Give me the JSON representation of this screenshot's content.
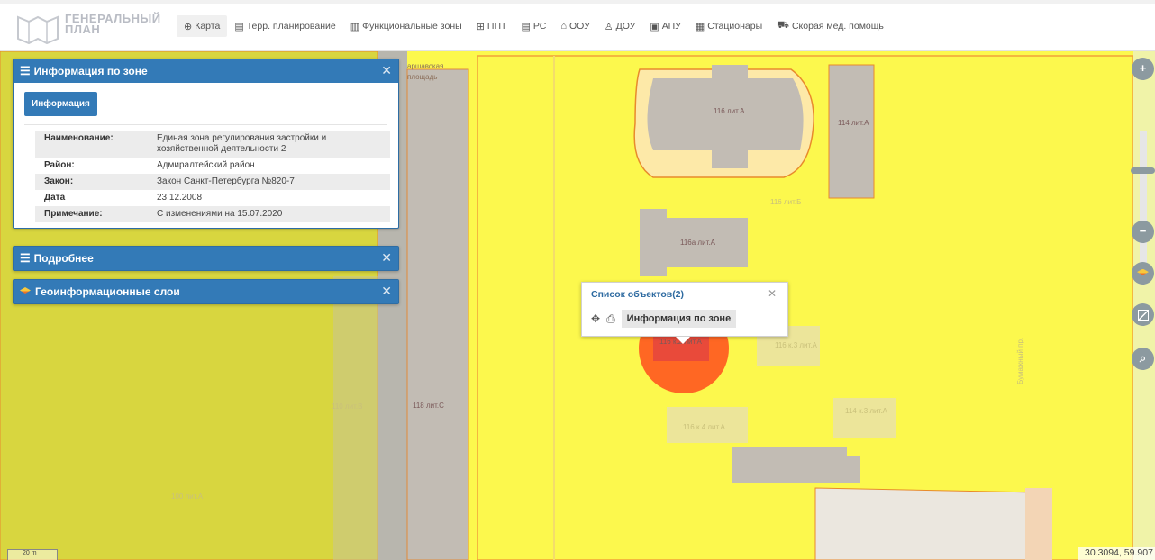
{
  "header": {
    "logo_line1": "ГЕНЕРАЛЬНЫЙ",
    "logo_line2": "ПЛАН",
    "nav": [
      {
        "label": "Карта",
        "icon": "globe-icon",
        "active": true
      },
      {
        "label": "Терр. планирование",
        "icon": "document-icon"
      },
      {
        "label": "Функциональные зоны",
        "icon": "list-icon"
      },
      {
        "label": "ППТ",
        "icon": "table-icon"
      },
      {
        "label": "РС",
        "icon": "file-icon"
      },
      {
        "label": "ООУ",
        "icon": "school-icon"
      },
      {
        "label": "ДОУ",
        "icon": "kindergarten-icon"
      },
      {
        "label": "АПУ",
        "icon": "clinic-icon"
      },
      {
        "label": "Стационары",
        "icon": "hospital-icon"
      },
      {
        "label": "Скорая мед. помощь",
        "icon": "ambulance-icon"
      }
    ]
  },
  "zone_panel": {
    "title": "Информация по зоне",
    "tab_button": "Информация",
    "rows": [
      {
        "key": "Наименование:",
        "value": "Единая зона регулирования застройки и хозяйственной деятельности 2"
      },
      {
        "key": "Район:",
        "value": "Адмиралтейский район"
      },
      {
        "key": "Закон:",
        "value": "Закон Санкт-Петербурга №820-7"
      },
      {
        "key": "Дата",
        "value": "23.12.2008"
      },
      {
        "key": "Примечание:",
        "value": "С изменениями на 15.07.2020"
      }
    ]
  },
  "details_panel": {
    "title": "Подробнее"
  },
  "layers_panel": {
    "title": "Геоинформационные слои"
  },
  "popup": {
    "title": "Список объектов(2)",
    "item_label": "Информация по зоне"
  },
  "map_labels": {
    "b116": "116 лит.А",
    "b114": "114 лит.А",
    "b116a": "116а лит.А",
    "b118c": "118 лит.С",
    "b116mid": "116 к.2 лит.А",
    "street_top1": "аршавская",
    "street_top2": "площадь",
    "street_right": "Бумажный пр.",
    "faint1": "116 лит.Б",
    "faint2": "116 к.3 лит.А",
    "faint3": "114 к.3 лит.А",
    "faint4": "116 к.4 лит.А",
    "faint5": "110 лит.В",
    "faint6": "100 лит.А"
  },
  "controls": {
    "zoom_in": "+",
    "zoom_out": "−"
  },
  "scale": "20 m",
  "coordinates": "30.3094, 59.907",
  "colors": {
    "primary": "#337ab7",
    "zone_fill": "#fcf84d",
    "building": "#c2bcb4",
    "highlight": "#ff5a1f"
  }
}
